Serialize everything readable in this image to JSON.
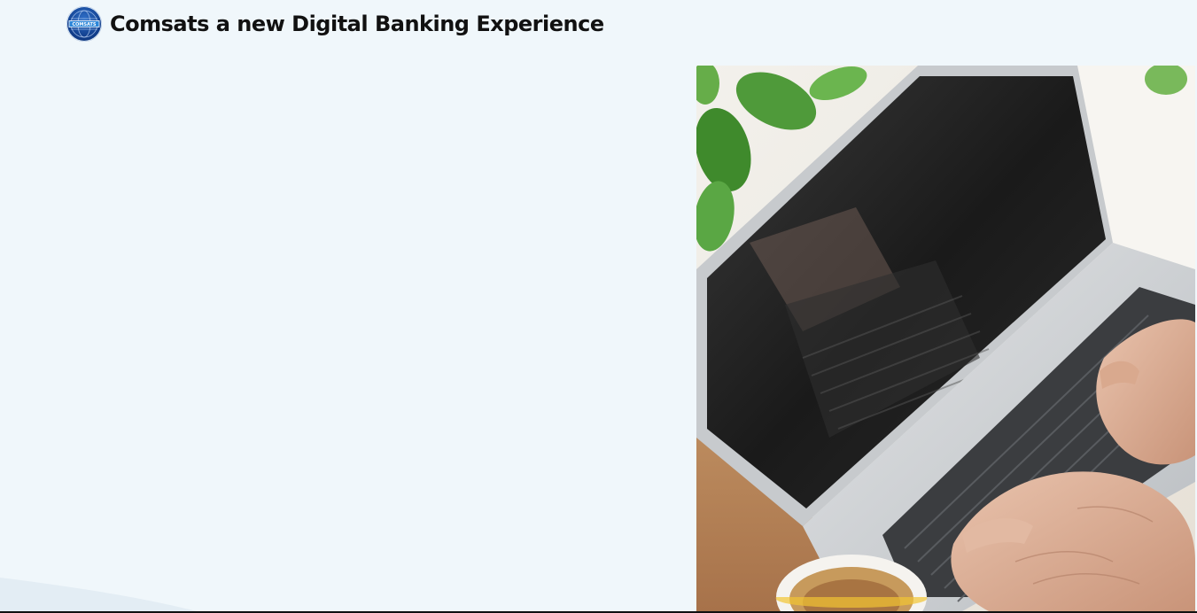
{
  "header": {
    "logo_text": "COMSATS",
    "title": "Comsats a new Digital Banking Experience"
  },
  "hero": {
    "image_icon": "laptop-typing-photo"
  },
  "colors": {
    "page_background": "#f0f7fb",
    "logo_blue": "#12408f",
    "title_text": "#111111"
  }
}
